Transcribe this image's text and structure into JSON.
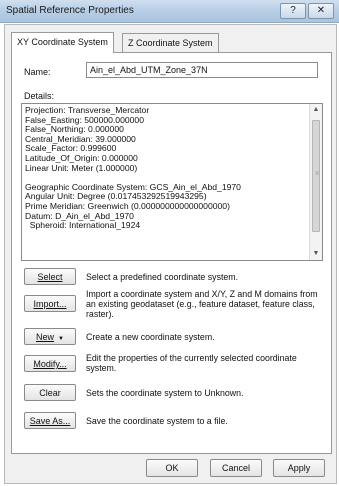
{
  "window": {
    "title": "Spatial Reference Properties",
    "help_symbol": "?",
    "close_symbol": "✕"
  },
  "tabs": [
    {
      "label": "XY Coordinate System",
      "active": true
    },
    {
      "label": "Z Coordinate System",
      "active": false
    }
  ],
  "name": {
    "label": "Name:",
    "value": "Ain_el_Abd_UTM_Zone_37N"
  },
  "details": {
    "label": "Details:",
    "text": "Projection: Transverse_Mercator\nFalse_Easting: 500000.000000\nFalse_Northing: 0.000000\nCentral_Meridian: 39.000000\nScale_Factor: 0.999600\nLatitude_Of_Origin: 0.000000\nLinear Unit: Meter (1.000000)\n\nGeographic Coordinate System: GCS_Ain_el_Abd_1970\nAngular Unit: Degree (0.017453292519943295)\nPrime Meridian: Greenwich (0.000000000000000000)\nDatum: D_Ain_el_Abd_1970\n  Spheroid: International_1924"
  },
  "actions": [
    {
      "label": "Select",
      "desc": "Select a predefined coordinate system."
    },
    {
      "label": "Import...",
      "desc": "Import a coordinate system and X/Y, Z and M domains from an existing geodataset (e.g., feature dataset, feature class, raster)."
    },
    {
      "label": "New",
      "desc": "Create a new coordinate system.",
      "dropdown": "▼"
    },
    {
      "label": "Modify...",
      "desc": "Edit the properties of the currently selected coordinate system."
    },
    {
      "label": "Clear",
      "desc": "Sets the coordinate system to Unknown."
    },
    {
      "label": "Save As...",
      "desc": "Save the coordinate system to a file."
    }
  ],
  "footer": {
    "ok": "OK",
    "cancel": "Cancel",
    "apply": "Apply"
  }
}
